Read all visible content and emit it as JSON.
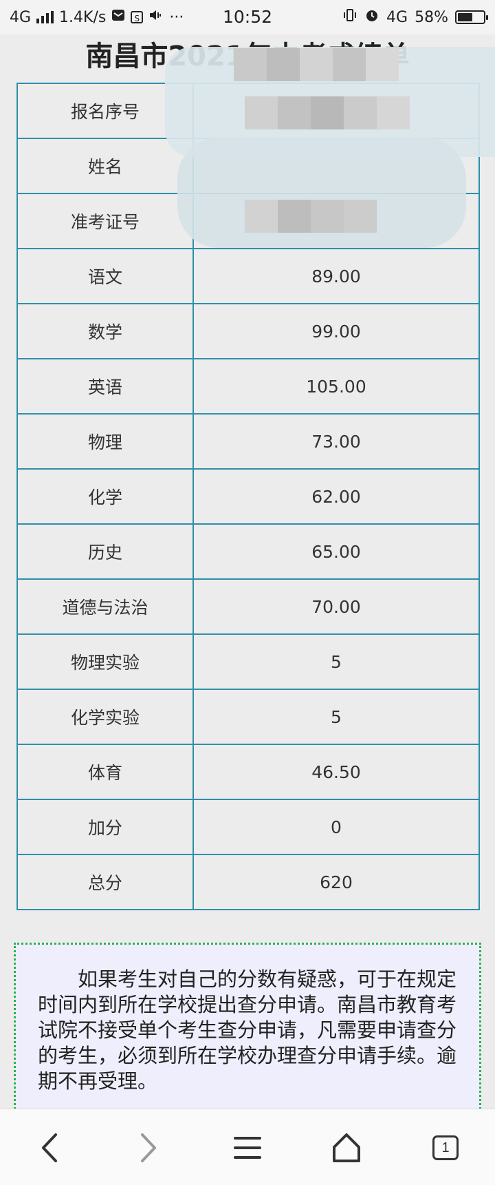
{
  "status_bar": {
    "network": "4G",
    "speed": "1.4K/s",
    "time": "10:52",
    "network2": "4G",
    "battery": "58%",
    "battery_level": 0.58,
    "more": "···",
    "s_badge": "S"
  },
  "page": {
    "title": "南昌市2021年中考成绩单"
  },
  "table": {
    "rows": [
      {
        "subject": "报名序号",
        "value": ""
      },
      {
        "subject": "姓名",
        "value": ""
      },
      {
        "subject": "准考证号",
        "value": ""
      },
      {
        "subject": "语文",
        "value": "89.00"
      },
      {
        "subject": "数学",
        "value": "99.00"
      },
      {
        "subject": "英语",
        "value": "105.00"
      },
      {
        "subject": "物理",
        "value": "73.00"
      },
      {
        "subject": "化学",
        "value": "62.00"
      },
      {
        "subject": "历史",
        "value": "65.00"
      },
      {
        "subject": "道德与法治",
        "value": "70.00"
      },
      {
        "subject": "物理实验",
        "value": "5"
      },
      {
        "subject": "化学实验",
        "value": "5"
      },
      {
        "subject": "体育",
        "value": "46.50"
      },
      {
        "subject": "加分",
        "value": "0"
      },
      {
        "subject": "总分",
        "value": "620"
      }
    ]
  },
  "notice": {
    "text": "如果考生对自己的分数有疑惑，可于在规定时间内到所在学校提出查分申请。南昌市教育考试院不接受单个考生查分申请，凡需要申请查分的考生，必须到所在学校办理查分申请手续。逾期不再受理。"
  },
  "bottom_nav": {
    "tab_count": "1"
  },
  "icons": {
    "back": "chevron-left-icon",
    "forward": "chevron-right-icon",
    "menu": "menu-icon",
    "home": "home-icon",
    "tabs": "tabs-icon"
  },
  "colors": {
    "table_border": "#2e8fa9",
    "notice_border": "#28b34b",
    "notice_bg": "#eeeefc",
    "page_bg": "#ececec"
  }
}
